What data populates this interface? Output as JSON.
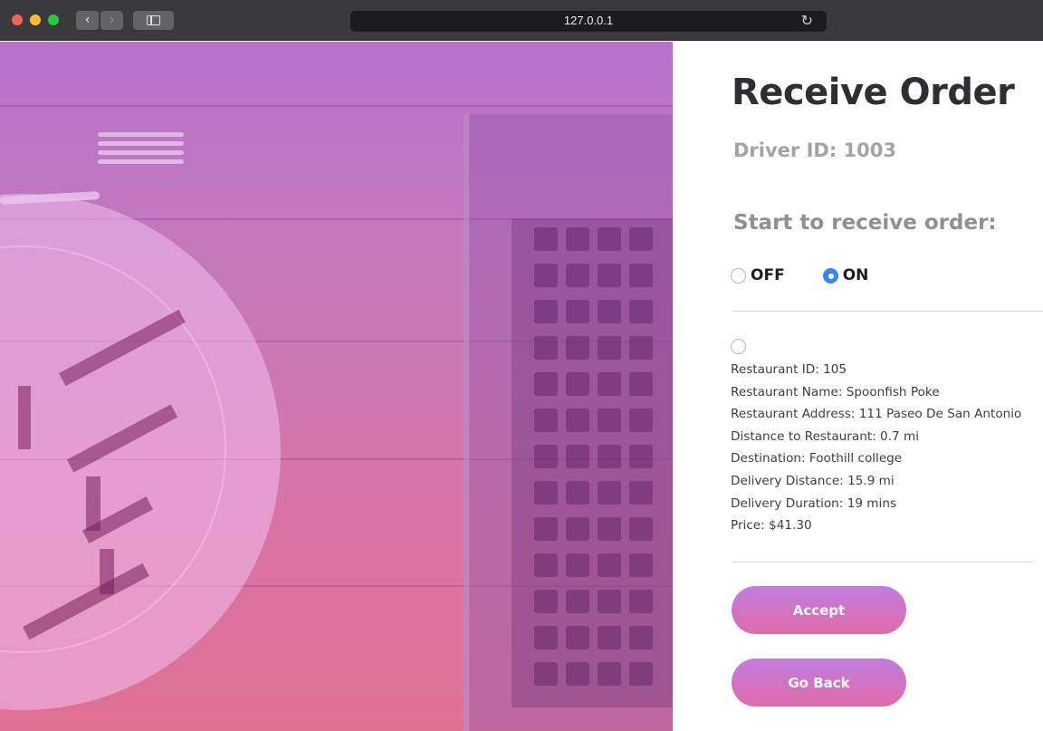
{
  "browser": {
    "url": "127.0.0.1",
    "back_label": "‹",
    "forward_label": "›",
    "reload_icon": "↻"
  },
  "page": {
    "title": "Receive Order",
    "driver_id": "Driver ID: 1003",
    "start_label": "Start to receive order:",
    "toggle": {
      "off_label": "OFF",
      "on_label": "ON",
      "selected": "ON"
    },
    "order": {
      "restaurant_id": "Restaurant ID: 105",
      "restaurant_name": "Restaurant Name: Spoonfish Poke",
      "restaurant_address": "Restaurant Address: 111 Paseo De San Antonio",
      "distance_to_restaurant": "Distance to Restaurant: 0.7 mi",
      "destination": "Destination: Foothill college",
      "delivery_distance": "Delivery Distance: 15.9 mi",
      "delivery_duration": "Delivery Duration: 19 mins",
      "price": "Price: $41.30"
    },
    "buttons": {
      "accept": "Accept",
      "go_back": "Go Back"
    }
  },
  "colors": {
    "accent": "#3a86f0",
    "button_gradient_top": "#c07ee0",
    "button_gradient_bottom": "#e06aa8",
    "title": "#2e2e33"
  }
}
